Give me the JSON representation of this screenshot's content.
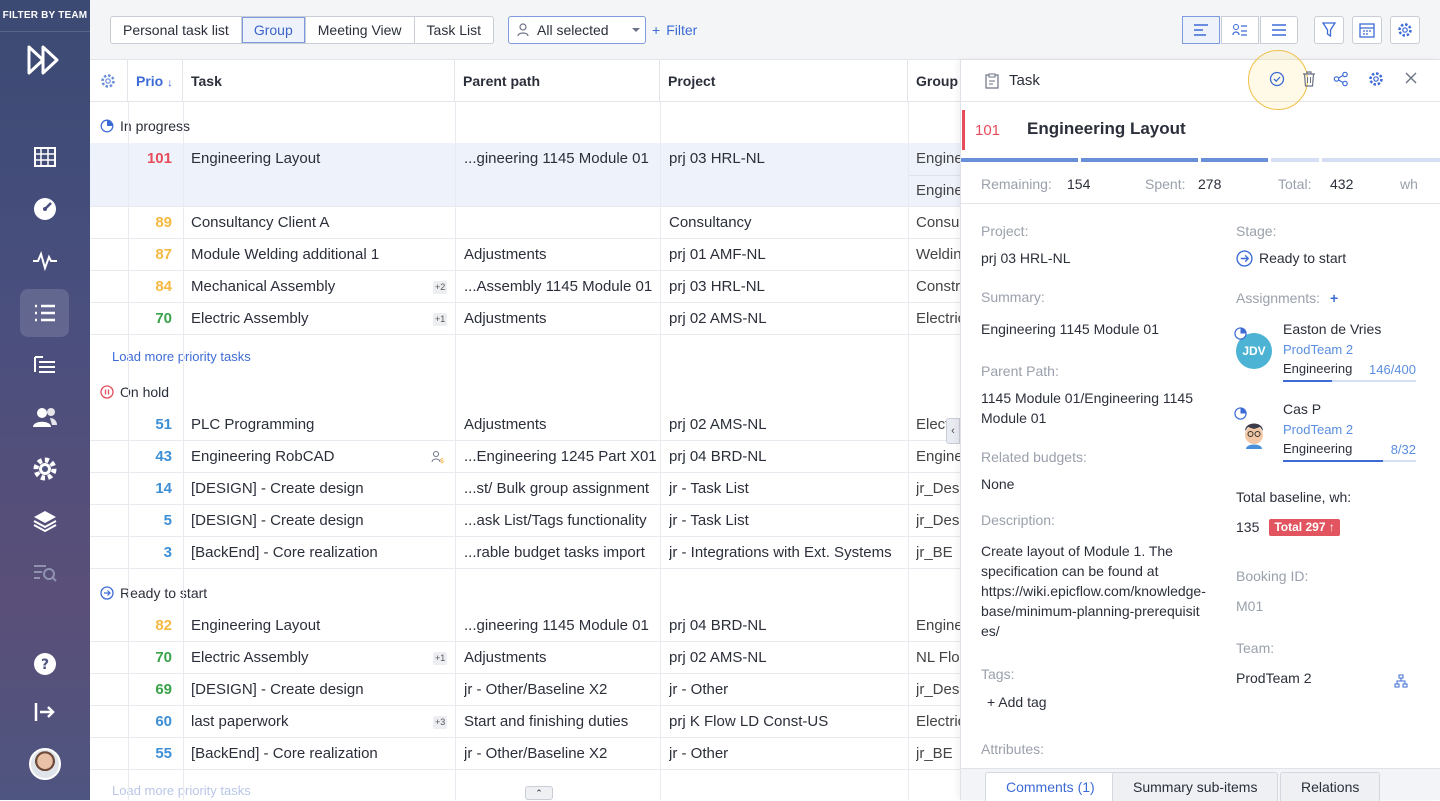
{
  "sidebar": {
    "filter_label": "FILTER BY TEAM"
  },
  "toolbar": {
    "views": [
      "Personal task list",
      "Group",
      "Meeting View",
      "Task List"
    ],
    "active_view": "Group",
    "selection": "All selected",
    "filter_label": "Filter"
  },
  "grid": {
    "headers": {
      "prio": "Prio",
      "task": "Task",
      "parent": "Parent path",
      "project": "Project",
      "group": "Group"
    },
    "groups": [
      {
        "label": "In progress"
      },
      {
        "label": "On hold"
      },
      {
        "label": "Ready to start"
      }
    ],
    "rows": [
      {
        "prio": "101",
        "task": "Engineering Layout",
        "parent": "...gineering 1145 Module 01",
        "project": "prj 03 HRL-NL",
        "group": "Engineering",
        "group2": "Engineering",
        "color": "#e74c5a",
        "badge": ""
      },
      {
        "prio": "89",
        "task": "Consultancy Client A",
        "parent": "",
        "project": "Consultancy",
        "group": "Consultancy",
        "color": "#f5b942",
        "badge": ""
      },
      {
        "prio": "87",
        "task": "Module Welding additional 1",
        "parent": "Adjustments",
        "project": "prj 01 AMF-NL",
        "group": "Welding",
        "color": "#f5b942",
        "badge": ""
      },
      {
        "prio": "84",
        "task": "Mechanical Assembly",
        "parent": "...Assembly 1145 Module 01",
        "project": "prj 03 HRL-NL",
        "group": "Construction",
        "color": "#f5b942",
        "badge": "+2"
      },
      {
        "prio": "70",
        "task": "Electric Assembly",
        "parent": "Adjustments",
        "project": "prj 02 AMS-NL",
        "group": "Electric",
        "color": "#3aa34a",
        "badge": "+1"
      },
      {
        "prio": "51",
        "task": "PLC Programming",
        "parent": "Adjustments",
        "project": "prj 02 AMS-NL",
        "group": "Electric",
        "color": "#3d8fd6",
        "badge": ""
      },
      {
        "prio": "43",
        "task": "Engineering RobCAD",
        "parent": "...Engineering 1245 Part X01",
        "project": "prj 04 BRD-NL",
        "group": "Engineering",
        "color": "#3d8fd6",
        "badge": ""
      },
      {
        "prio": "14",
        "task": "[DESIGN] - Create design",
        "parent": "...st/ Bulk group assignment",
        "project": "jr - Task List",
        "group": "jr_Design",
        "color": "#3d8fd6",
        "badge": ""
      },
      {
        "prio": "5",
        "task": "[DESIGN] - Create design",
        "parent": "...ask List/Tags functionality",
        "project": "jr - Task List",
        "group": "jr_Design",
        "color": "#3d8fd6",
        "badge": ""
      },
      {
        "prio": "3",
        "task": "[BackEnd] - Core realization",
        "parent": "...rable budget tasks import",
        "project": "jr - Integrations with Ext. Systems",
        "group": "jr_BE",
        "color": "#3d8fd6",
        "badge": ""
      },
      {
        "prio": "82",
        "task": "Engineering Layout",
        "parent": "...gineering 1145 Module 01",
        "project": "prj 04 BRD-NL",
        "group": "Engineering",
        "color": "#f5b942",
        "badge": ""
      },
      {
        "prio": "70",
        "task": "Electric Assembly",
        "parent": "Adjustments",
        "project": "prj 02 AMS-NL",
        "group": "NL Floor",
        "color": "#3aa34a",
        "badge": "+1"
      },
      {
        "prio": "69",
        "task": "[DESIGN] - Create design",
        "parent": "jr - Other/Baseline X2",
        "project": "jr - Other",
        "group": "jr_Design",
        "color": "#3aa34a",
        "badge": ""
      },
      {
        "prio": "60",
        "task": "last paperwork",
        "parent": "Start and finishing duties",
        "project": "prj K Flow LD Const-US",
        "group": "Electric",
        "color": "#3d8fd6",
        "badge": "+3"
      },
      {
        "prio": "55",
        "task": "[BackEnd] - Core realization",
        "parent": "jr - Other/Baseline X2",
        "project": "jr - Other",
        "group": "jr_BE",
        "color": "#3d8fd6",
        "badge": ""
      }
    ],
    "load_more": "Load more priority tasks"
  },
  "panel": {
    "header": "Task",
    "prio": "101",
    "title": "Engineering Layout",
    "remaining_label": "Remaining:",
    "remaining": "154",
    "spent_label": "Spent:",
    "spent": "278",
    "total_label": "Total:",
    "total": "432",
    "unit": "wh",
    "project_label": "Project:",
    "project": "prj 03 HRL-NL",
    "summary_label": "Summary:",
    "summary": "Engineering 1145 Module 01",
    "parent_label": "Parent Path:",
    "parent": "1145 Module 01/Engineering 1145 Module 01",
    "budgets_label": "Related budgets:",
    "budgets": "None",
    "desc_label": "Description:",
    "desc": "Create layout of Module 1. The specification can be found at",
    "desc_link": "https://wiki.epicflow.com/knowledge-base/minimum-planning-prerequisites/",
    "tags_label": "Tags:",
    "add_tag": "Add tag",
    "attributes_label": "Attributes:",
    "stage_label": "Stage:",
    "stage": "Ready to start",
    "assignments_label": "Assignments:",
    "assignees": [
      {
        "name": "Easton de Vries",
        "initials": "JDV",
        "team": "ProdTeam 2",
        "group": "Engineering",
        "hours": "146/400",
        "progress": 0.37
      },
      {
        "name": "Cas P",
        "initials": "",
        "team": "ProdTeam 2",
        "group": "Engineering",
        "hours": "8/32",
        "progress": 0.75
      }
    ],
    "baseline_label": "Total baseline, wh:",
    "baseline": "135",
    "baseline_total": "Total 297 ↑",
    "booking_label": "Booking ID:",
    "booking": "M01",
    "team_label": "Team:",
    "team": "ProdTeam 2",
    "tabs": [
      "Comments (1)",
      "Summary sub-items",
      "Relations"
    ]
  },
  "colors": {
    "accent": "#3d6bd6",
    "danger": "#e74c5a",
    "sidebar": "#4a4f7e"
  }
}
